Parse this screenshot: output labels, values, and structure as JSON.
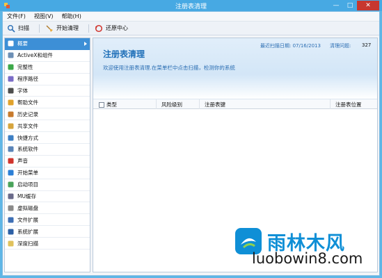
{
  "window": {
    "title": "注册表清理",
    "minimize": "—",
    "maximize": "□",
    "close": "✕"
  },
  "menu": [
    {
      "label": "文件(F)"
    },
    {
      "label": "视图(V)"
    },
    {
      "label": "帮助(H)"
    }
  ],
  "toolbar": {
    "scan_label": "扫描",
    "clean_label": "开始清理",
    "restore_label": "还原中心"
  },
  "sidebar": {
    "items": [
      {
        "label": "概要",
        "icon": "grid-icon",
        "active": true
      },
      {
        "label": "ActiveX和组件",
        "icon": "activex-icon"
      },
      {
        "label": "完整性",
        "icon": "leaf-icon"
      },
      {
        "label": "程序路径",
        "icon": "program-path-icon"
      },
      {
        "label": "字体",
        "icon": "font-icon"
      },
      {
        "label": "帮助文件",
        "icon": "help-file-icon"
      },
      {
        "label": "历史记录",
        "icon": "history-icon"
      },
      {
        "label": "共享文件",
        "icon": "shared-file-icon"
      },
      {
        "label": "快捷方式",
        "icon": "shortcut-icon"
      },
      {
        "label": "系统软件",
        "icon": "system-software-icon"
      },
      {
        "label": "声音",
        "icon": "sound-icon"
      },
      {
        "label": "开始菜单",
        "icon": "start-menu-icon"
      },
      {
        "label": "启动项目",
        "icon": "startup-icon"
      },
      {
        "label": "MU缓存",
        "icon": "cache-icon"
      },
      {
        "label": "虚拟磁盘",
        "icon": "disk-icon"
      },
      {
        "label": "文件扩展",
        "icon": "file-extension-icon"
      },
      {
        "label": "系统扩展",
        "icon": "system-extension-icon"
      },
      {
        "label": "深度扫描",
        "icon": "deep-scan-icon"
      }
    ]
  },
  "banner": {
    "heading": "注册表清理",
    "description": "欢迎使用注册表清理.在菜单栏中点击扫描，检测你的系统",
    "last_scan_label": "最近扫描日期: 07/16/2013",
    "issues_label": "清理问题:",
    "issues_count": "327"
  },
  "table": {
    "columns": [
      "类型",
      "风险级别",
      "注册表键",
      "注册表位置"
    ]
  },
  "watermark": {
    "cn": "雨林木风",
    "en": "luobowin8.com"
  },
  "colors": {
    "accent": "#3d8fd6",
    "title_bar": "#47a9e3",
    "heading": "#1f6fb8",
    "watermark": "#0f8fd6"
  }
}
